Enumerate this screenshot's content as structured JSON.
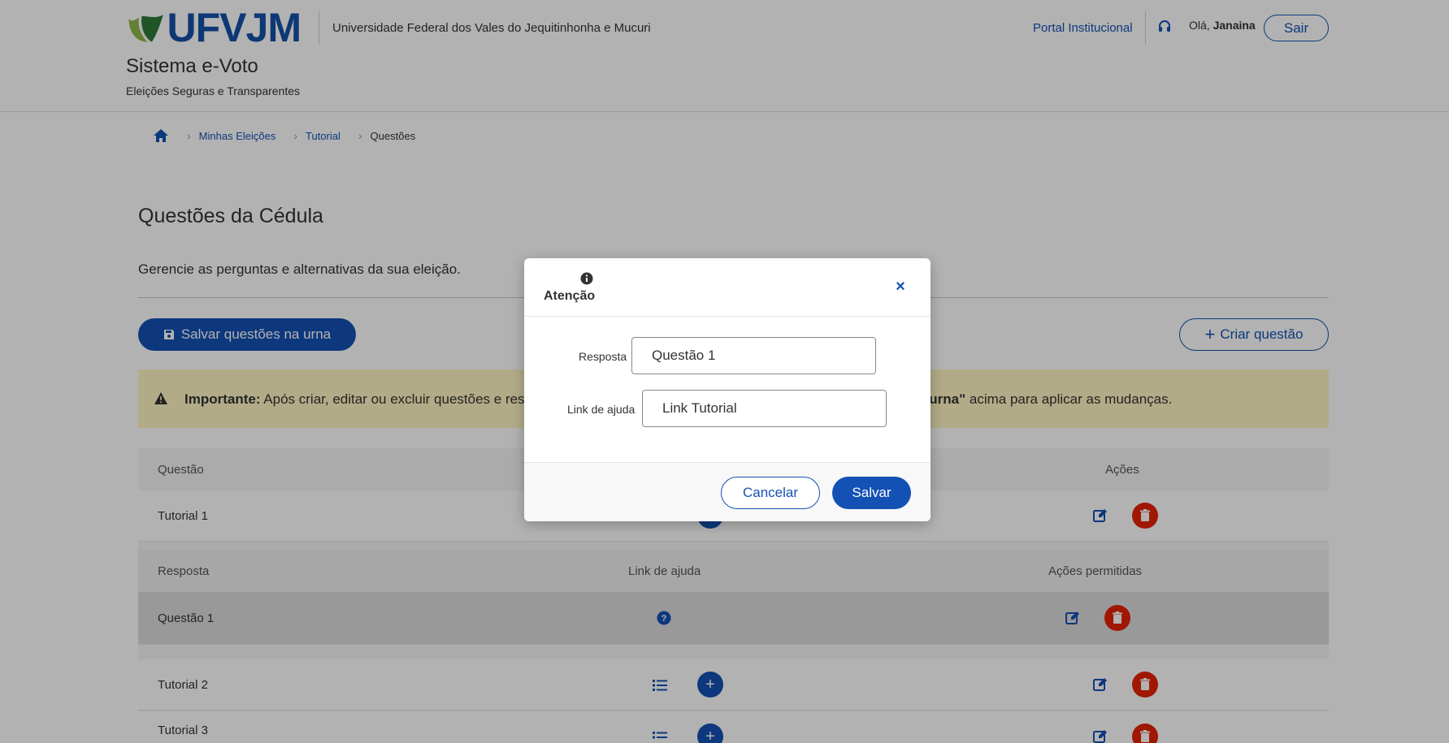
{
  "header": {
    "logo_text": "UFVJM",
    "university": "Universidade Federal dos Vales do Jequitinhonha e Mucuri",
    "system_title": "Sistema e-Voto",
    "system_subtitle": "Eleições Seguras e Transparentes",
    "portal_link": "Portal Institucional",
    "greeting_prefix": "Olá,",
    "user_name": "Janaina",
    "logout_label": "Sair"
  },
  "breadcrumb": {
    "items": [
      "Minhas Eleições",
      "Tutorial",
      "Questões"
    ]
  },
  "page": {
    "title": "Questões da Cédula",
    "description": "Gerencie as perguntas e alternativas da sua eleição.",
    "save_button": "Salvar questões na urna",
    "create_button": "Criar questão"
  },
  "alert": {
    "strong": "Importante:",
    "text_start": " Após criar, editar ou excluir questões e res",
    "strong_end": "stões na urna\"",
    "text_end": " acima para aplicar as mudanças."
  },
  "table": {
    "headers": {
      "question": "Questão",
      "actions": "Ações"
    },
    "sub_headers": {
      "answer": "Resposta",
      "help_link": "Link de ajuda",
      "allowed_actions": "Ações permitidas"
    },
    "rows": [
      "Tutorial 1",
      "Tutorial 2",
      "Tutorial 3"
    ],
    "answers": [
      "Questão 1"
    ]
  },
  "modal": {
    "title": "Atenção",
    "field_answer_label": "Resposta",
    "field_answer_value": "Questão 1",
    "field_help_label": "Link de ajuda",
    "field_help_value": "Link Tutorial",
    "cancel_label": "Cancelar",
    "save_label": "Salvar",
    "close_symbol": "×"
  },
  "colors": {
    "primary": "#1351b4",
    "danger": "#e52207",
    "alert_bg": "#fff5c2"
  }
}
